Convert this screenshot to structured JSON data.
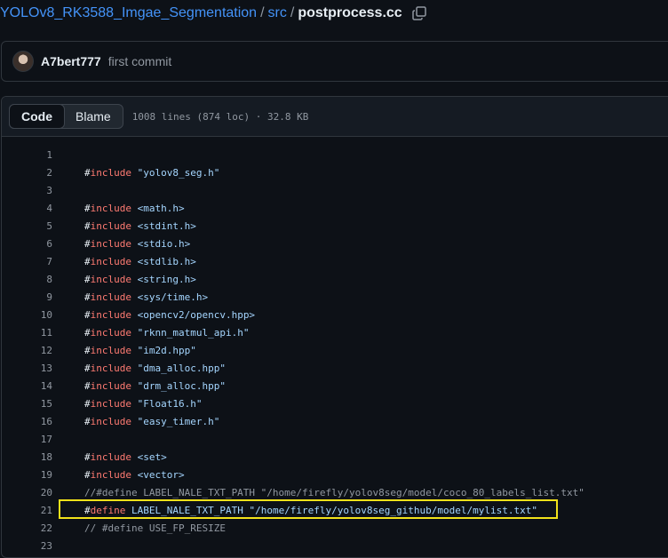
{
  "breadcrumb": {
    "repo": "YOLOv8_RK3588_Imgae_Segmentation",
    "folder": "src",
    "file": "postprocess.cc",
    "separator": "/"
  },
  "commit": {
    "author": "A7bert777",
    "message": "first commit"
  },
  "file_header": {
    "tabs": [
      "Code",
      "Blame"
    ],
    "active_tab": "Code",
    "meta": "1008 lines (874 loc) · 32.8 KB"
  },
  "code_lines": [
    {
      "n": "1",
      "parts": []
    },
    {
      "n": "2",
      "parts": [
        {
          "t": "#",
          "c": "txt"
        },
        {
          "t": "include",
          "c": "kw"
        },
        {
          "t": " \"yolov8_seg.h\"",
          "c": "str"
        }
      ]
    },
    {
      "n": "3",
      "parts": []
    },
    {
      "n": "4",
      "parts": [
        {
          "t": "#",
          "c": "txt"
        },
        {
          "t": "include",
          "c": "kw"
        },
        {
          "t": " <math.h>",
          "c": "str"
        }
      ]
    },
    {
      "n": "5",
      "parts": [
        {
          "t": "#",
          "c": "txt"
        },
        {
          "t": "include",
          "c": "kw"
        },
        {
          "t": " <stdint.h>",
          "c": "str"
        }
      ]
    },
    {
      "n": "6",
      "parts": [
        {
          "t": "#",
          "c": "txt"
        },
        {
          "t": "include",
          "c": "kw"
        },
        {
          "t": " <stdio.h>",
          "c": "str"
        }
      ]
    },
    {
      "n": "7",
      "parts": [
        {
          "t": "#",
          "c": "txt"
        },
        {
          "t": "include",
          "c": "kw"
        },
        {
          "t": " <stdlib.h>",
          "c": "str"
        }
      ]
    },
    {
      "n": "8",
      "parts": [
        {
          "t": "#",
          "c": "txt"
        },
        {
          "t": "include",
          "c": "kw"
        },
        {
          "t": " <string.h>",
          "c": "str"
        }
      ]
    },
    {
      "n": "9",
      "parts": [
        {
          "t": "#",
          "c": "txt"
        },
        {
          "t": "include",
          "c": "kw"
        },
        {
          "t": " <sys/time.h>",
          "c": "str"
        }
      ]
    },
    {
      "n": "10",
      "parts": [
        {
          "t": "#",
          "c": "txt"
        },
        {
          "t": "include",
          "c": "kw"
        },
        {
          "t": " <opencv2/opencv.hpp>",
          "c": "str"
        }
      ]
    },
    {
      "n": "11",
      "parts": [
        {
          "t": "#",
          "c": "txt"
        },
        {
          "t": "include",
          "c": "kw"
        },
        {
          "t": " \"rknn_matmul_api.h\"",
          "c": "str"
        }
      ]
    },
    {
      "n": "12",
      "parts": [
        {
          "t": "#",
          "c": "txt"
        },
        {
          "t": "include",
          "c": "kw"
        },
        {
          "t": " \"im2d.hpp\"",
          "c": "str"
        }
      ]
    },
    {
      "n": "13",
      "parts": [
        {
          "t": "#",
          "c": "txt"
        },
        {
          "t": "include",
          "c": "kw"
        },
        {
          "t": " \"dma_alloc.hpp\"",
          "c": "str"
        }
      ]
    },
    {
      "n": "14",
      "parts": [
        {
          "t": "#",
          "c": "txt"
        },
        {
          "t": "include",
          "c": "kw"
        },
        {
          "t": " \"drm_alloc.hpp\"",
          "c": "str"
        }
      ]
    },
    {
      "n": "15",
      "parts": [
        {
          "t": "#",
          "c": "txt"
        },
        {
          "t": "include",
          "c": "kw"
        },
        {
          "t": " \"Float16.h\"",
          "c": "str"
        }
      ]
    },
    {
      "n": "16",
      "parts": [
        {
          "t": "#",
          "c": "txt"
        },
        {
          "t": "include",
          "c": "kw"
        },
        {
          "t": " \"easy_timer.h\"",
          "c": "str"
        }
      ]
    },
    {
      "n": "17",
      "parts": []
    },
    {
      "n": "18",
      "parts": [
        {
          "t": "#",
          "c": "txt"
        },
        {
          "t": "include",
          "c": "kw"
        },
        {
          "t": " <set>",
          "c": "str"
        }
      ]
    },
    {
      "n": "19",
      "parts": [
        {
          "t": "#",
          "c": "txt"
        },
        {
          "t": "include",
          "c": "kw"
        },
        {
          "t": " <vector>",
          "c": "str"
        }
      ]
    },
    {
      "n": "20",
      "parts": [
        {
          "t": "//#define LABEL_NALE_TXT_PATH \"/home/firefly/yolov8seg/model/coco_80_labels_list.txt\"",
          "c": "cm"
        }
      ]
    },
    {
      "n": "21",
      "parts": [
        {
          "t": "#",
          "c": "txt"
        },
        {
          "t": "define",
          "c": "kw"
        },
        {
          "t": " LABEL_NALE_TXT_PATH ",
          "c": "str"
        },
        {
          "t": "\"/home/firefly/yolov8seg_github/model/mylist.txt\"",
          "c": "str"
        }
      ]
    },
    {
      "n": "22",
      "parts": [
        {
          "t": "// #define USE_FP_RESIZE",
          "c": "cm"
        }
      ]
    },
    {
      "n": "23",
      "parts": []
    }
  ]
}
